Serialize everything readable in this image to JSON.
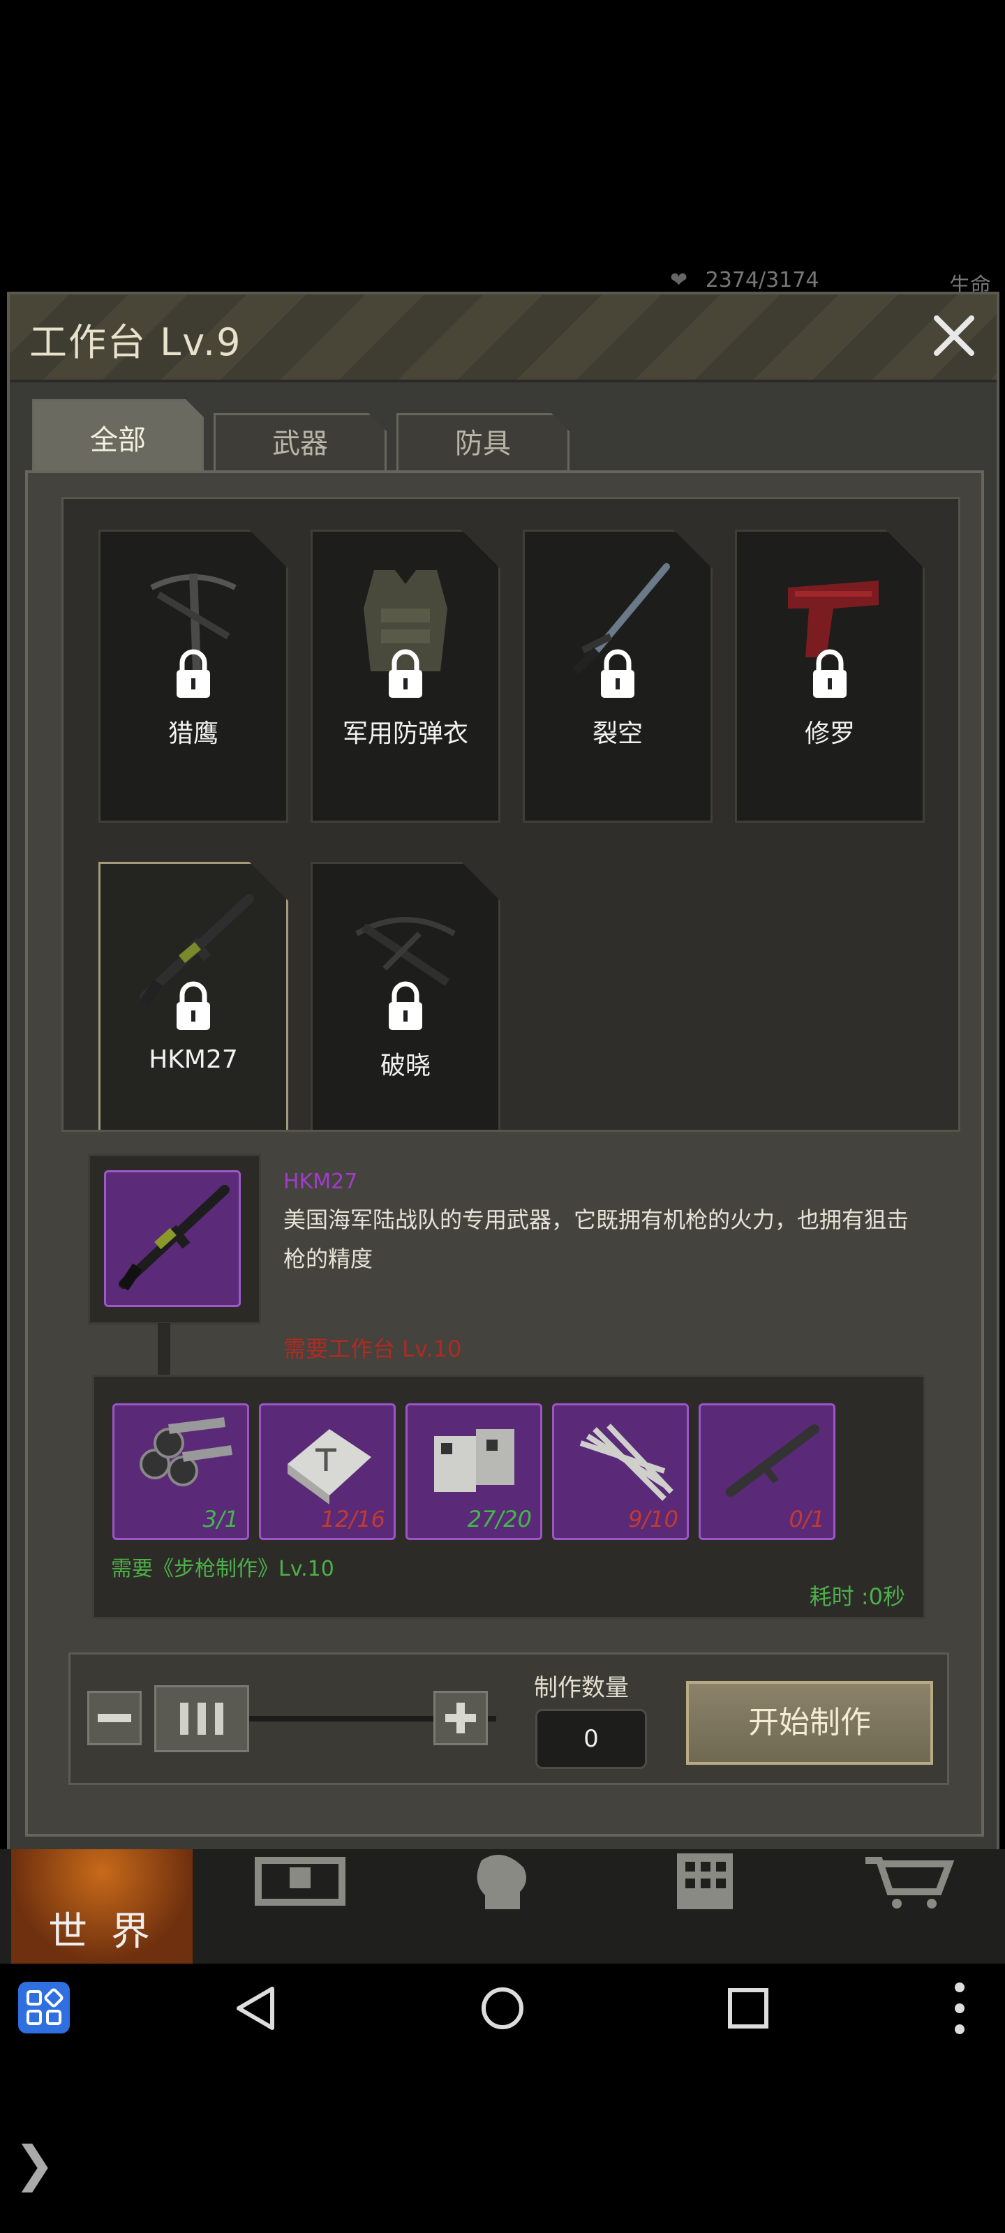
{
  "top_status": {
    "stamina": "2374/3174",
    "life_label": "生命"
  },
  "dialog": {
    "title": "工作台 Lv.9",
    "close_icon": "close-icon"
  },
  "tabs": [
    {
      "label": "全部",
      "active": true
    },
    {
      "label": "武器",
      "active": false
    },
    {
      "label": "防具",
      "active": false
    }
  ],
  "items": [
    {
      "name": "猎鹰",
      "icon": "crossbow-icon",
      "locked": true
    },
    {
      "name": "军用防弹衣",
      "icon": "body-armor-icon",
      "locked": true
    },
    {
      "name": "裂空",
      "icon": "sword-icon",
      "locked": true
    },
    {
      "name": "修罗",
      "icon": "pistol-icon",
      "locked": true
    },
    {
      "name": "HKM27",
      "icon": "rifle-icon",
      "locked": true,
      "selected": true
    },
    {
      "name": "破晓",
      "icon": "crossbow-icon",
      "locked": true
    }
  ],
  "detail": {
    "name": "HKM27",
    "description": "美国海军陆战队的专用武器，它既拥有机枪的火力，也拥有狙击枪的精度",
    "requirement": "需要工作台 Lv.10"
  },
  "materials": [
    {
      "icon": "pipes-icon",
      "count": "3/1",
      "sufficient": true
    },
    {
      "icon": "metal-block-icon",
      "count": "12/16",
      "sufficient": false
    },
    {
      "icon": "gun-parts-icon",
      "count": "27/20",
      "sufficient": true
    },
    {
      "icon": "metal-strips-icon",
      "count": "9/10",
      "sufficient": false
    },
    {
      "icon": "rifle-barrel-icon",
      "count": "0/1",
      "sufficient": false
    }
  ],
  "recipe_requirement": "需要《步枪制作》Lv.10",
  "time_cost": "耗时 :0秒",
  "controls": {
    "quantity_label": "制作数量",
    "quantity_value": "0",
    "start_label": "开始制作"
  },
  "bottom_nav": {
    "world_label": "世 界"
  },
  "colors": {
    "rare_purple": "#5a2a78",
    "ok_green": "#42b84a",
    "bad_red": "#c23a30",
    "requirement_red": "#b02a22"
  }
}
